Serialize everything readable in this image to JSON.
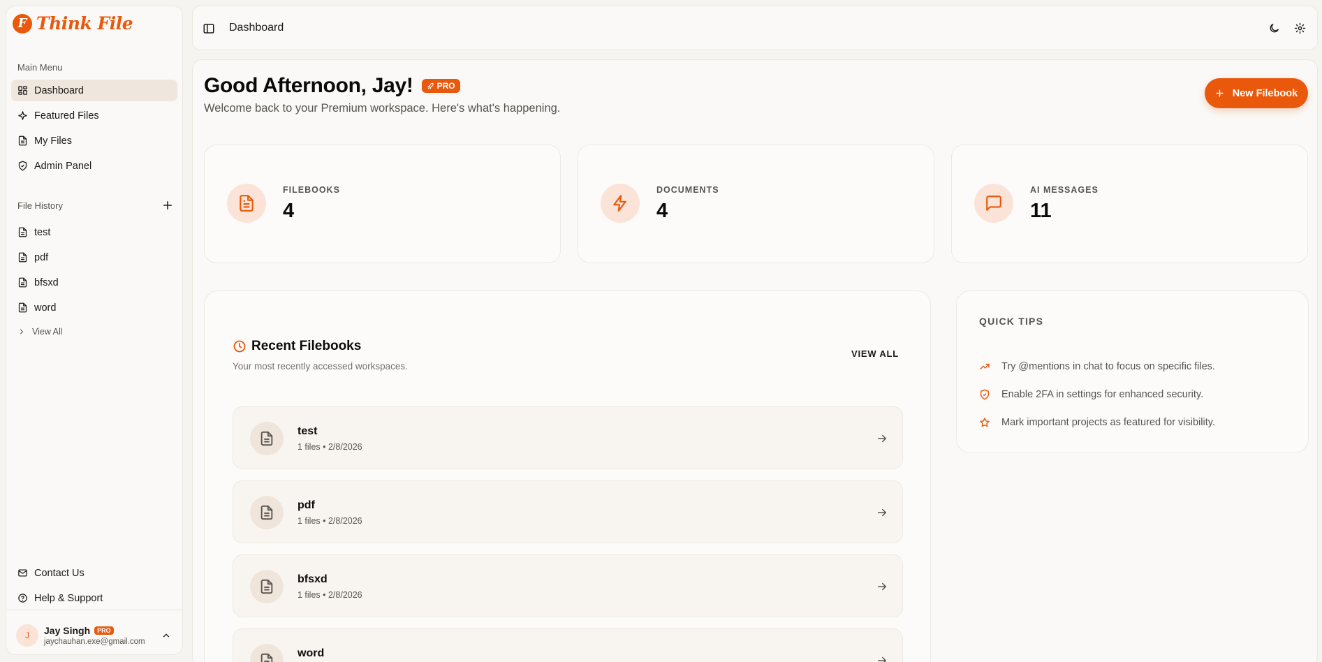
{
  "app": {
    "logo_text": "Think File",
    "logo_mark": "F"
  },
  "sidebar": {
    "main_menu_label": "Main Menu",
    "menu": [
      {
        "label": "Dashboard",
        "icon": "dashboard-icon",
        "active": true
      },
      {
        "label": "Featured Files",
        "icon": "sparkle-icon"
      },
      {
        "label": "My Files",
        "icon": "file-icon"
      },
      {
        "label": "Admin Panel",
        "icon": "shield-icon"
      }
    ],
    "history_label": "File History",
    "history": [
      {
        "label": "test"
      },
      {
        "label": "pdf"
      },
      {
        "label": "bfsxd"
      },
      {
        "label": "word"
      }
    ],
    "view_all_label": "View All",
    "footer": [
      {
        "label": "Contact Us",
        "icon": "mail-icon"
      },
      {
        "label": "Help & Support",
        "icon": "help-circle-icon"
      }
    ],
    "user": {
      "initial": "J",
      "name": "Jay Singh",
      "badge": "PRO",
      "email": "jaychauhan.exe@gmail.com"
    }
  },
  "header": {
    "breadcrumb": "Dashboard"
  },
  "main": {
    "greeting": "Good Afternoon, Jay!",
    "badge": "PRO",
    "subtitle": "Welcome back to your Premium workspace. Here's what's happening.",
    "new_button": "New Filebook",
    "stats": [
      {
        "label": "FILEBOOKS",
        "value": "4",
        "icon": "document-icon"
      },
      {
        "label": "DOCUMENTS",
        "value": "4",
        "icon": "lightning-icon"
      },
      {
        "label": "AI MESSAGES",
        "value": "11",
        "icon": "chat-icon"
      }
    ],
    "recent": {
      "title": "Recent Filebooks",
      "subtitle": "Your most recently accessed workspaces.",
      "view_all": "VIEW ALL",
      "items": [
        {
          "name": "test",
          "meta": "1 files • 2/8/2026"
        },
        {
          "name": "pdf",
          "meta": "1 files • 2/8/2026"
        },
        {
          "name": "bfsxd",
          "meta": "1 files • 2/8/2026"
        },
        {
          "name": "word",
          "meta": ""
        }
      ]
    },
    "tips": {
      "title": "QUICK TIPS",
      "items": [
        {
          "text": "Try @mentions in chat to focus on specific files.",
          "icon": "trending-up-icon"
        },
        {
          "text": "Enable 2FA in settings for enhanced security.",
          "icon": "shield-check-icon"
        },
        {
          "text": "Mark important projects as featured for visibility.",
          "icon": "star-icon"
        }
      ]
    }
  },
  "colors": {
    "accent": "#ea580c",
    "accent_soft": "#fbe4d7",
    "background": "#f6f4f0",
    "active_nav": "#efe7de"
  }
}
